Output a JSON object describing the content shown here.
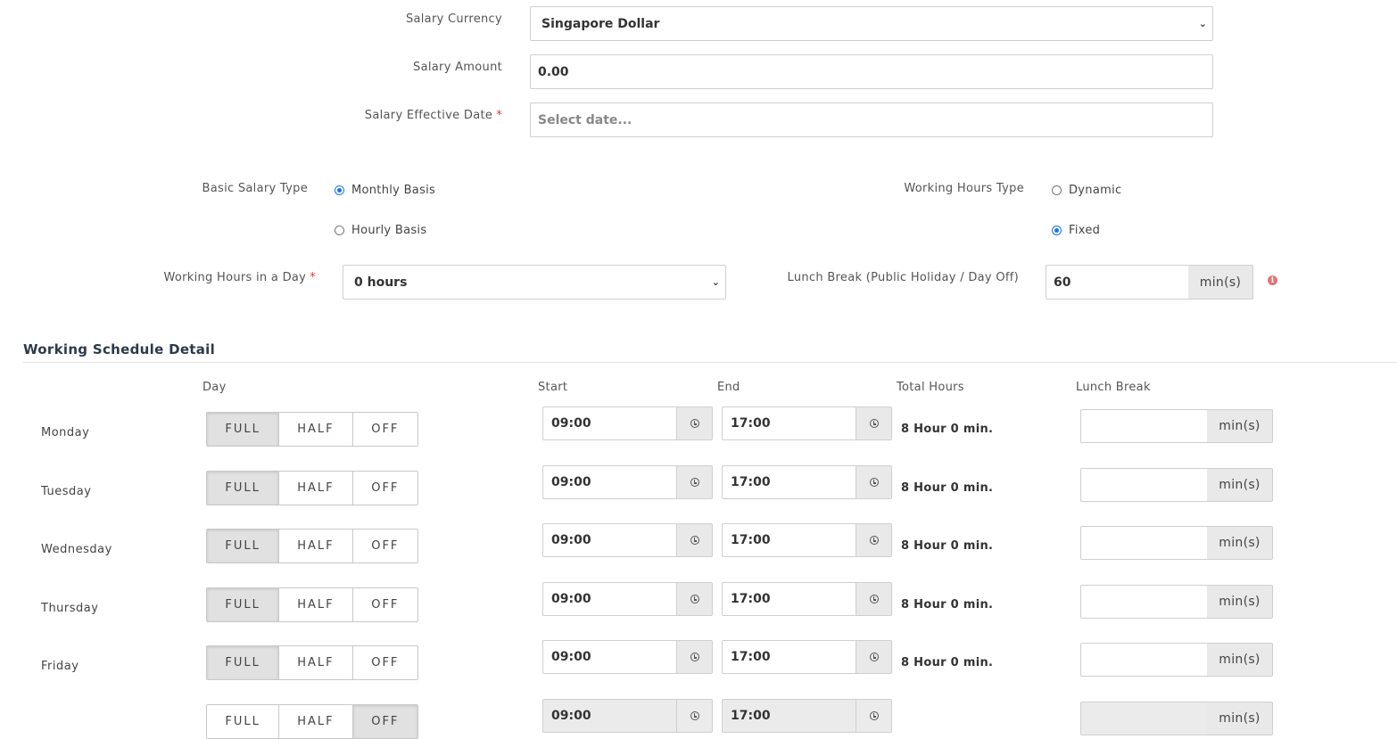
{
  "salary": {
    "currency_label": "Salary Currency",
    "currency_value": "Singapore Dollar",
    "amount_label": "Salary Amount",
    "amount_value": "0.00",
    "effective_date_label": "Salary Effective Date",
    "effective_date_placeholder": "Select date...",
    "required_mark": "*"
  },
  "basic_salary_type": {
    "label": "Basic Salary Type",
    "options": [
      {
        "label": "Monthly Basis",
        "selected": true
      },
      {
        "label": "Hourly Basis",
        "selected": false
      }
    ]
  },
  "working_hours_type": {
    "label": "Working Hours Type",
    "options": [
      {
        "label": "Dynamic",
        "selected": false
      },
      {
        "label": "Fixed",
        "selected": true
      }
    ]
  },
  "working_hours_day": {
    "label": "Working Hours in a Day",
    "value": "0 hours"
  },
  "lunch_break_holiday": {
    "label": "Lunch Break (Public Holiday / Day Off)",
    "value": "60",
    "unit": "min(s)"
  },
  "schedule": {
    "title": "Working Schedule Detail",
    "headers": {
      "day": "Day",
      "start": "Start",
      "end": "End",
      "total": "Total Hours",
      "lunch": "Lunch Break"
    },
    "segment_labels": {
      "full": "FULL",
      "half": "HALF",
      "off": "OFF"
    },
    "lunch_unit": "min(s)",
    "rows": [
      {
        "day": "Monday",
        "mode": "FULL",
        "start": "09:00",
        "end": "17:00",
        "total": "8 Hour 0 min."
      },
      {
        "day": "Tuesday",
        "mode": "FULL",
        "start": "09:00",
        "end": "17:00",
        "total": "8 Hour 0 min."
      },
      {
        "day": "Wednesday",
        "mode": "FULL",
        "start": "09:00",
        "end": "17:00",
        "total": "8 Hour 0 min."
      },
      {
        "day": "Thursday",
        "mode": "FULL",
        "start": "09:00",
        "end": "17:00",
        "total": "8 Hour 0 min."
      },
      {
        "day": "Friday",
        "mode": "FULL",
        "start": "09:00",
        "end": "17:00",
        "total": "8 Hour 0 min."
      },
      {
        "day": "",
        "mode": "OFF",
        "start": "09:00",
        "end": "17:00",
        "total": ""
      }
    ]
  }
}
